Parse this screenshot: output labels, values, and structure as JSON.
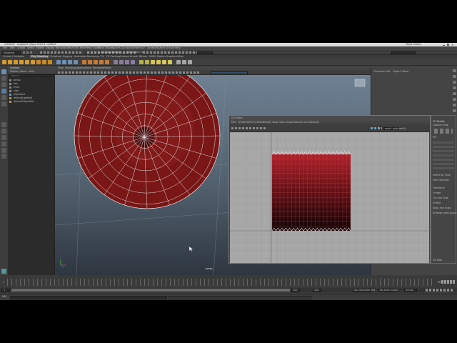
{
  "window": {
    "title": "untitled* - Autodesk Maya 2023.3: untitled",
    "workspace": "Maya Classic"
  },
  "menubar": {
    "items": [
      "File",
      "Edit",
      "Create",
      "Select",
      "Modify",
      "Display",
      "Windows",
      "Mesh",
      "Edit Mesh",
      "Mesh Tools",
      "Mesh Display",
      "Curves",
      "Surfaces",
      "Deform",
      "UV",
      "Generate",
      "Cache",
      "Arnold",
      "Help"
    ]
  },
  "statusline": {
    "mode": "Modeling",
    "live_surface": "No Live Surface",
    "symmetry": "Symmetry: Off"
  },
  "shelf": {
    "tabs": [
      "Curves / Surfaces",
      "Poly Modeling",
      "Sculpting",
      "Rigging",
      "Animation",
      "Rendering",
      "FX",
      "FX Caching",
      "Custom",
      "Arnold",
      "Bifrost",
      "MASH",
      "Motion Graphics",
      "XGen"
    ]
  },
  "outliner": {
    "menus": [
      "Display",
      "Show",
      "Help"
    ],
    "search_placeholder": "Search...",
    "items": [
      "persp",
      "top",
      "front",
      "side",
      "pSphere1",
      "defaultLightSet",
      "defaultObjectSet"
    ]
  },
  "viewport": {
    "menus": [
      "View",
      "Shading",
      "Lighting",
      "Show",
      "Renderer",
      "Panels"
    ],
    "camera_label": "persp"
  },
  "channel_box": {
    "tabs": [
      "Channels",
      "Edit",
      "Object",
      "Show"
    ]
  },
  "uv_editor": {
    "title": "UV Editor",
    "menus": [
      "Edit",
      "Create",
      "Select",
      "Cut/Sew",
      "Modify",
      "Tools",
      "View",
      "Image",
      "Textures",
      "UV Sets",
      "Help"
    ],
    "uv_set_label": "map1 (pSphere1)"
  },
  "uv_toolkit": {
    "title": "UV Toolkit",
    "tabs": [
      "Options",
      "Help"
    ],
    "sections": [
      "Pin",
      "Select By Type",
      "Soft Selection",
      "Transform",
      "Create",
      "Cut and Sew",
      "Unfold",
      "Align and Snap",
      "Arrange and Layout",
      "UV Sets"
    ]
  },
  "timeline": {
    "start": "1",
    "end": "120",
    "range_end": "200",
    "current_frame": "1",
    "character_set": "No Character Set",
    "anim_layer": "No Anim Layer",
    "fps": "24 fps"
  },
  "command_line": {
    "language": "MEL"
  },
  "colors": {
    "mesh_red": "#7a1616",
    "uv_red": "#b0202a",
    "background": "#444444"
  }
}
